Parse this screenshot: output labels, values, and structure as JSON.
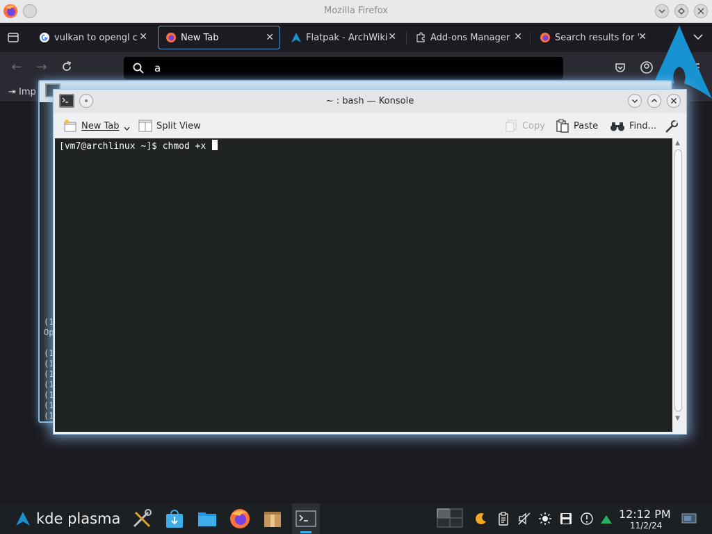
{
  "firefox": {
    "window_title": "Mozilla Firefox",
    "tabs": [
      {
        "label": "vulkan to opengl c"
      },
      {
        "label": "New Tab"
      },
      {
        "label": "Flatpak - ArchWiki"
      },
      {
        "label": "Add-ons Manager"
      },
      {
        "label": "Search results for '"
      }
    ],
    "tab_close_glyph": "✕",
    "url_value": "a",
    "bookmark_label": "Imp"
  },
  "background_terminal": {
    "lines": [
      "(1",
      "Op",
      "(1",
      "(1",
      "(1",
      "(1",
      "(1",
      "(1",
      "(1"
    ]
  },
  "konsole": {
    "title": "~ : bash — Konsole",
    "toolbar": {
      "new_tab": "New Tab",
      "split_view": "Split View",
      "copy": "Copy",
      "paste": "Paste",
      "find": "Find..."
    },
    "terminal_line": "[vm7@archlinux ~]$ chmod +x "
  },
  "taskbar": {
    "launcher_label": "kde plasma",
    "clock_time": "12:12 PM",
    "clock_date": "11/2/24"
  },
  "colors": {
    "terminal_bg": "#1f2321",
    "focus_glow": "#8cc3f0",
    "arch_blue": "#1793d1"
  }
}
